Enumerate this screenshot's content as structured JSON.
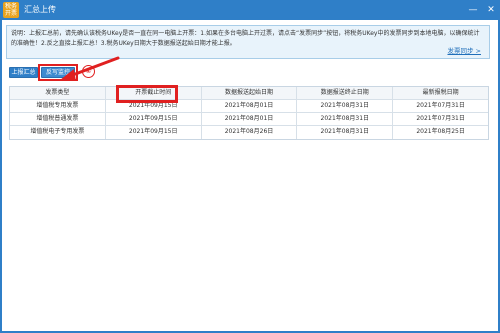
{
  "window": {
    "icon_text": "税务\n开票",
    "title": "汇总上传",
    "minimize": "—",
    "close": "✕"
  },
  "notice": {
    "text": "说明：上报汇总前，请先确认该税务UKey是否一直在同一电脑上开票：1.如果在多台电脑上开过票，请点击“发票同步”按钮，将税务UKey中的发票同步到本地电脑，以确保统计的准确性！2.反之直接上报汇总！3.税务UKey日期大于数据报送起始日期才能上报。",
    "link": "发票同步 >"
  },
  "toolbar": {
    "upload_label": "上报汇总",
    "monitor_label": "反写监控",
    "step_badge": "④"
  },
  "table": {
    "columns": [
      "发票类型",
      "开票截止时间",
      "数据报送起始日期",
      "数据报送终止日期",
      "最新报税日期"
    ],
    "rows": [
      [
        "增值税专用发票",
        "2021年09月15日",
        "2021年08月01日",
        "2021年08月31日",
        "2021年07月31日"
      ],
      [
        "增值税普通发票",
        "2021年09月15日",
        "2021年08月01日",
        "2021年08月31日",
        "2021年07月31日"
      ],
      [
        "增值税电子专用发票",
        "2021年09月15日",
        "2021年08月26日",
        "2021年08月31日",
        "2021年08月25日"
      ]
    ]
  },
  "colors": {
    "accent": "#2f7fc8",
    "highlight": "#e02020",
    "notice_bg": "#e8f3fb"
  },
  "annotations": {
    "highlighted_column": "开票截止时间",
    "highlighted_button": "反写监控"
  }
}
